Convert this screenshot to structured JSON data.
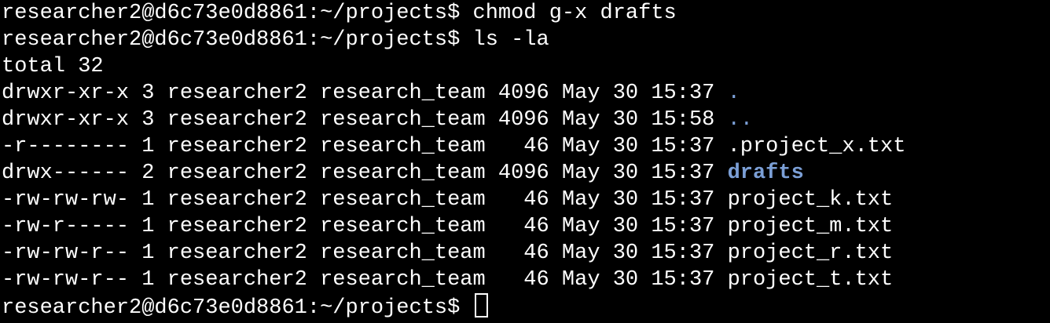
{
  "terminal": {
    "lines": [
      {
        "prompt": "researcher2@d6c73e0d8861:~/projects$ ",
        "command": "chmod g-x drafts"
      },
      {
        "prompt": "researcher2@d6c73e0d8861:~/projects$ ",
        "command": "ls -la"
      },
      {
        "text": "total 32"
      }
    ],
    "listing": [
      {
        "prefix": "drwxr-xr-x 3 researcher2 research_team 4096 May 30 15:37 ",
        "name": ".",
        "kind": "dir"
      },
      {
        "prefix": "drwxr-xr-x 3 researcher2 research_team 4096 May 30 15:58 ",
        "name": "..",
        "kind": "dir"
      },
      {
        "prefix": "-r-------- 1 researcher2 research_team   46 May 30 15:37 ",
        "name": ".project_x.txt",
        "kind": "file"
      },
      {
        "prefix": "drwx------ 2 researcher2 research_team 4096 May 30 15:37 ",
        "name": "drafts",
        "kind": "dir-bold"
      },
      {
        "prefix": "-rw-rw-rw- 1 researcher2 research_team   46 May 30 15:37 ",
        "name": "project_k.txt",
        "kind": "file"
      },
      {
        "prefix": "-rw-r----- 1 researcher2 research_team   46 May 30 15:37 ",
        "name": "project_m.txt",
        "kind": "file"
      },
      {
        "prefix": "-rw-rw-r-- 1 researcher2 research_team   46 May 30 15:37 ",
        "name": "project_r.txt",
        "kind": "file"
      },
      {
        "prefix": "-rw-rw-r-- 1 researcher2 research_team   46 May 30 15:37 ",
        "name": "project_t.txt",
        "kind": "file"
      }
    ],
    "final_prompt": "researcher2@d6c73e0d8861:~/projects$ ",
    "colors": {
      "background": "#000000",
      "foreground": "#ffffff",
      "directory": "#7b9fd6"
    }
  }
}
